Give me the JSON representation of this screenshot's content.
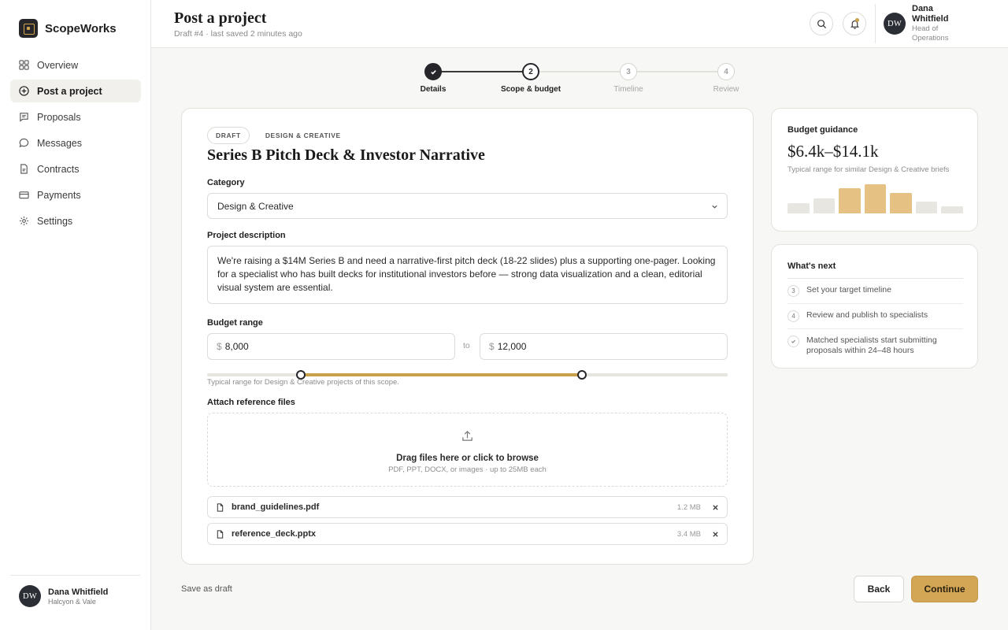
{
  "app": {
    "name": "ScopeWorks"
  },
  "nav": [
    {
      "label": "Overview",
      "icon": "grid-icon",
      "active": false
    },
    {
      "label": "Post a project",
      "icon": "plus-circle-icon",
      "active": true
    },
    {
      "label": "Proposals",
      "icon": "message-square-icon",
      "active": false
    },
    {
      "label": "Messages",
      "icon": "message-circle-icon",
      "active": false
    },
    {
      "label": "Contracts",
      "icon": "file-icon",
      "active": false
    },
    {
      "label": "Payments",
      "icon": "card-icon",
      "active": false
    },
    {
      "label": "Settings",
      "icon": "gear-icon",
      "active": false
    }
  ],
  "sidebar_user": {
    "initials": "DW",
    "name": "Dana Whitfield",
    "org": "Halcyon & Vale"
  },
  "header": {
    "title": "Post a project",
    "subtitle": "Draft #4 · last saved 2 minutes ago",
    "user": {
      "initials": "DW",
      "name": "Dana Whitfield",
      "role": "Head of Operations"
    }
  },
  "stepper": {
    "steps": [
      {
        "num": "1",
        "label": "Details",
        "state": "done"
      },
      {
        "num": "2",
        "label": "Scope & budget",
        "state": "current"
      },
      {
        "num": "3",
        "label": "Timeline",
        "state": "pending"
      },
      {
        "num": "4",
        "label": "Review",
        "state": "pending"
      }
    ]
  },
  "form": {
    "status_chip": "DRAFT",
    "category_chip": "DESIGN & CREATIVE",
    "project_title": "Series B Pitch Deck & Investor Narrative",
    "category_label": "Category",
    "category_value": "Design & Creative",
    "description_label": "Project description",
    "description_value": "We're raising a $14M Series B and need a narrative-first pitch deck (18-22 slides) plus a supporting one-pager. Looking for a specialist who has built decks for institutional investors before — strong data visualization and a clean, editorial visual system are essential.",
    "budget_label": "Budget range",
    "currency": "$",
    "budget_min": "8,000",
    "budget_max": "12,000",
    "to_label": "to",
    "slider": {
      "min_fraction": 0.18,
      "max_fraction": 0.72
    },
    "budget_hint": "Typical range for Design & Creative projects of this scope.",
    "attach_label": "Attach reference files",
    "dropzone_title": "Drag files here or click to browse",
    "dropzone_sub": "PDF, PPT, DOCX, or images · up to 25MB each",
    "files": [
      {
        "name": "brand_guidelines.pdf",
        "size": "1.2 MB"
      },
      {
        "name": "reference_deck.pptx",
        "size": "3.4 MB"
      }
    ]
  },
  "guidance": {
    "title": "Budget guidance",
    "amount": "$6.4k–$14.1k",
    "subtitle": "Typical range for similar Design & Creative briefs",
    "distribution": [
      0.3,
      0.45,
      0.75,
      0.85,
      0.6,
      0.35,
      0.2
    ],
    "highlight": [
      false,
      false,
      true,
      true,
      true,
      false,
      false
    ],
    "color_highlight": "#e6c184",
    "color_base": "#e8e6e1"
  },
  "next": {
    "title": "What's next",
    "items": [
      {
        "marker": "3",
        "text": "Set your target timeline"
      },
      {
        "marker": "4",
        "text": "Review and publish to specialists"
      },
      {
        "marker": "check",
        "text": "Matched specialists start submitting proposals within 24–48 hours"
      }
    ]
  },
  "actions": {
    "save_draft": "Save as draft",
    "back": "Back",
    "continue": "Continue"
  },
  "colors": {
    "accent": "#d2a654",
    "dark": "#26262b"
  }
}
